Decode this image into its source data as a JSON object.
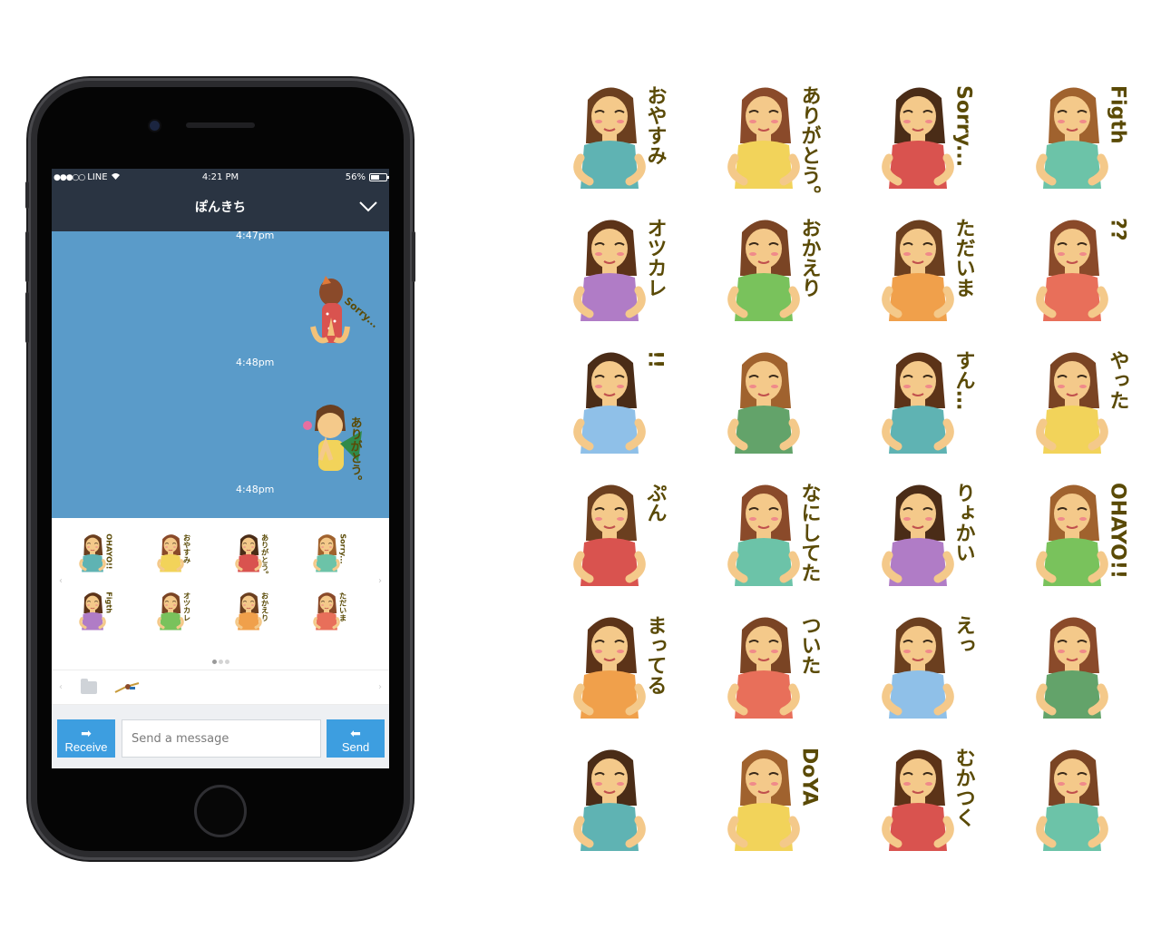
{
  "status_bar": {
    "carrier": "LINE",
    "time": "4:21 PM",
    "battery": "56%",
    "battery_level": 0.56
  },
  "chat": {
    "title": "ぽんきち",
    "messages": [
      {
        "time": "4:47pm"
      },
      {
        "time": "4:48pm",
        "sticker_caption": "Sorry..."
      },
      {
        "time": "4:48pm",
        "sticker_caption": "ありがとう。"
      }
    ]
  },
  "sticker_panel": {
    "page_count": 3,
    "active_page": 1,
    "thumbnails": [
      {
        "caption": "OHAYO!!"
      },
      {
        "caption": "おやすみ"
      },
      {
        "caption": "ありがとう。"
      },
      {
        "caption": "Sorry..."
      },
      {
        "caption": "Figth"
      },
      {
        "caption": "オツカレ"
      },
      {
        "caption": "おかえり"
      },
      {
        "caption": "ただいま"
      }
    ]
  },
  "input": {
    "placeholder": "Send a message",
    "receive_label": "Receive",
    "send_label": "Send"
  },
  "sticker_grid": [
    {
      "caption": "おやすみ"
    },
    {
      "caption": "ありがとう。"
    },
    {
      "caption": "Sorry..."
    },
    {
      "caption": "Figth"
    },
    {
      "caption": "オツカレ"
    },
    {
      "caption": "おかえり"
    },
    {
      "caption": "ただいま"
    },
    {
      "caption": "??"
    },
    {
      "caption": "!!"
    },
    {
      "caption": ""
    },
    {
      "caption": "すん…"
    },
    {
      "caption": "やった"
    },
    {
      "caption": "ぷん"
    },
    {
      "caption": "なにしてた"
    },
    {
      "caption": "りょかい"
    },
    {
      "caption": "OHAYO!!"
    },
    {
      "caption": "まってる"
    },
    {
      "caption": "ついた"
    },
    {
      "caption": "えっ"
    },
    {
      "caption": ""
    },
    {
      "caption": ""
    },
    {
      "caption": "DoYA"
    },
    {
      "caption": "むかつく"
    },
    {
      "caption": ""
    }
  ],
  "colors": {
    "chat_background": "#5a9bc9",
    "header_background": "#2a3442",
    "button_blue": "#3d9ee0",
    "caption_brown": "#5a4a06"
  }
}
